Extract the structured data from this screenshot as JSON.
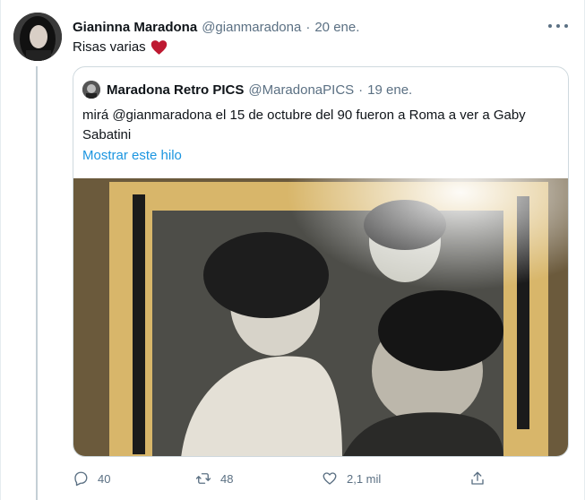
{
  "tweet": {
    "author_name": "Gianinna Maradona",
    "author_handle": "@gianmaradona",
    "separator": "·",
    "date": "20 ene.",
    "text": "Risas varias"
  },
  "quoted": {
    "author_name": "Maradona Retro PICS",
    "author_handle": "@MaradonaPICS",
    "separator": "·",
    "date": "19 ene.",
    "text": "mirá @gianmaradona el 15 de octubre del 90 fueron a Roma a ver a Gaby Sabatini",
    "show_thread": "Mostrar este hilo"
  },
  "actions": {
    "replies": "40",
    "retweets": "48",
    "likes": "2,1 mil"
  },
  "colors": {
    "accent": "#1b95e0",
    "heart": "#e0245e",
    "muted": "#5b7083",
    "border": "#cfd9de"
  },
  "icons": [
    "more-icon",
    "heart-emoji-icon",
    "reply-icon",
    "retweet-icon",
    "like-icon",
    "share-icon"
  ]
}
